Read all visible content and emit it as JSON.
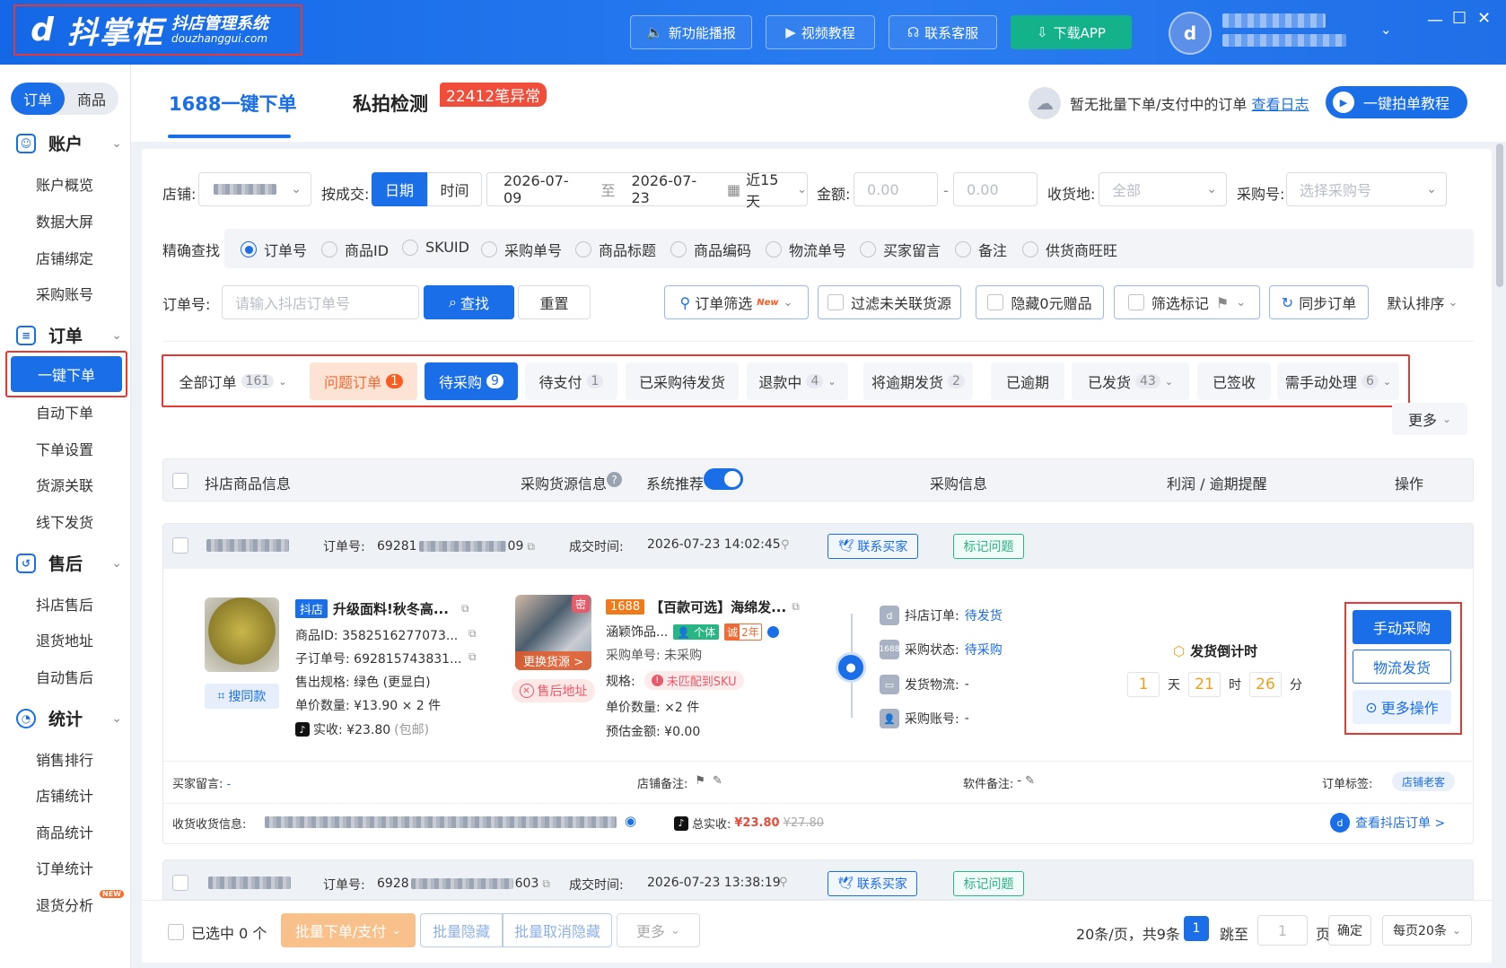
{
  "app": {
    "logo_brand": "抖掌柜",
    "logo_sub1": "抖店管理系统",
    "logo_sub2": "douzhanggui.com",
    "top_buttons": [
      "新功能播报",
      "视频教程",
      "联系客服",
      "下载APP"
    ]
  },
  "sidebar": {
    "seg": [
      "订单",
      "商品"
    ],
    "groups": [
      {
        "label": "账户",
        "items": [
          "账户概览",
          "数据大屏",
          "店铺绑定",
          "采购账号"
        ]
      },
      {
        "label": "订单",
        "items": [
          "一键下单",
          "自动下单",
          "下单设置",
          "货源关联",
          "线下发货"
        ]
      },
      {
        "label": "售后",
        "items": [
          "抖店售后",
          "退货地址",
          "自动售后"
        ]
      },
      {
        "label": "统计",
        "items": [
          "销售排行",
          "店铺统计",
          "商品统计",
          "订单统计",
          "退货分析"
        ]
      }
    ],
    "new_badge": "NEW"
  },
  "tabs": {
    "tab1": "1688一键下单",
    "tab2": "私拍检测",
    "tab2_badge": "22412笔异常",
    "notice": "暂无批量下单/支付中的订单",
    "notice_link": "查看日志",
    "tutorial": "一键拍单教程"
  },
  "filters": {
    "shop_label": "店铺:",
    "by_label": "按成交:",
    "by_date": "日期",
    "by_time": "时间",
    "date_from": "2026-07-09",
    "date_to_sep": "至",
    "date_to": "2026-07-23",
    "range": "近15天",
    "amount_label": "金额:",
    "amount_min_ph": "0.00",
    "amount_sep": "-",
    "amount_max_ph": "0.00",
    "recv_label": "收货地:",
    "recv_value": "全部",
    "po_label": "采购号:",
    "po_ph": "选择采购号",
    "precise_label": "精确查找",
    "radios": [
      "订单号",
      "商品ID",
      "SKUID",
      "采购单号",
      "商品标题",
      "商品编码",
      "物流单号",
      "买家留言",
      "备注",
      "供货商旺旺"
    ],
    "order_label": "订单号:",
    "order_ph": "请输入抖店订单号",
    "search": "查找",
    "reset": "重置",
    "order_filter": "订单筛选",
    "new_tag": "New",
    "filter_unlinked": "过滤未关联货源",
    "hide_gift": "隐藏0元赠品",
    "filter_mark": "筛选标记",
    "sync": "同步订单",
    "sort": "默认排序"
  },
  "status_tabs": [
    {
      "label": "全部订单",
      "count": "161"
    },
    {
      "label": "问题订单",
      "count": "1"
    },
    {
      "label": "待采购",
      "count": "9"
    },
    {
      "label": "待支付",
      "count": "1"
    },
    {
      "label": "已采购待发货",
      "count": ""
    },
    {
      "label": "退款中",
      "count": "4"
    },
    {
      "label": "将逾期发货",
      "count": "2"
    },
    {
      "label": "已逾期",
      "count": ""
    },
    {
      "label": "已发货",
      "count": "43"
    },
    {
      "label": "已签收",
      "count": ""
    },
    {
      "label": "需手动处理",
      "count": "6"
    }
  ],
  "more": "更多",
  "table_header": {
    "product": "抖店商品信息",
    "source": "采购货源信息",
    "recommend": "系统推荐",
    "purchase": "采购信息",
    "profit": "利润 / 逾期提醒",
    "op": "操作"
  },
  "order": {
    "order_no_label": "订单号:",
    "order_no_a": "69281",
    "order_no_b": "09",
    "time_label": "成交时间:",
    "time": "2026-07-23 14:02:45",
    "contact": "联系买家",
    "mark": "标记问题",
    "shop_tag": "抖店",
    "title": "升级面料!秋冬高...",
    "pid": "商品ID: 3582516277073...",
    "sub": "子订单号: 692815743831...",
    "spec": "售出规格: 绿色 (更显白)",
    "price": "单价数量: ¥13.90 × 2 件",
    "paid": "实收: ¥23.80",
    "paid_note": "(包邮)",
    "same": "搜同款",
    "src_tag": "1688",
    "src_title": "【百款可选】海绵发...",
    "src_shop": "涵颖饰品...",
    "indiv": "个体",
    "cheng": "诚",
    "years": "2年",
    "change_src": "更换货源 >",
    "after_addr": "售后地址",
    "mi": "密",
    "po_no": "采购单号: 未采购",
    "spec_label": "规格:",
    "unmatched": "未匹配到SKU",
    "qty": "单价数量: ×2 件",
    "est": "预估金额: ¥0.00",
    "s1_label": "抖店订单:",
    "s1_val": "待发货",
    "s2_label": "采购状态:",
    "s2_val": "待采购",
    "s3_label": "发货物流:",
    "s3_val": "-",
    "s4_label": "采购账号:",
    "s4_val": "-",
    "countdown_title": "发货倒计时",
    "cd_days": "1",
    "cd_day_u": "天",
    "cd_hours": "21",
    "cd_hour_u": "时",
    "cd_mins": "26",
    "cd_min_u": "分",
    "act_manual": "手动采购",
    "act_logistics": "物流发货",
    "act_more": "更多操作",
    "buyer_msg": "买家留言:",
    "buyer_msg_val": "-",
    "shop_note": "店铺备注:",
    "soft_note": "软件备注:",
    "soft_note_val": "-",
    "order_tag": "订单标签:",
    "order_tag_val": "店铺老客",
    "recv_info": "收货收货信息:",
    "total_label": "总实收:",
    "total": "¥23.80",
    "total_orig": "¥27.80",
    "view": "查看抖店订单 >"
  },
  "order2": {
    "order_no_label": "订单号:",
    "order_no_a": "6928",
    "order_no_b": "603",
    "time_label": "成交时间:",
    "time": "2026-07-23 13:38:19",
    "contact": "联系买家",
    "mark": "标记问题"
  },
  "footer": {
    "selected": "已选中 0 个",
    "batch_order": "批量下单/支付",
    "batch_hide": "批量隐藏",
    "batch_unhide": "批量取消隐藏",
    "more": "更多",
    "page_info": "20条/页，共9条",
    "page": "1",
    "jump": "跳至",
    "jump_val": "1",
    "page_u": "页",
    "confirm": "确定",
    "per_page": "每页20条"
  }
}
